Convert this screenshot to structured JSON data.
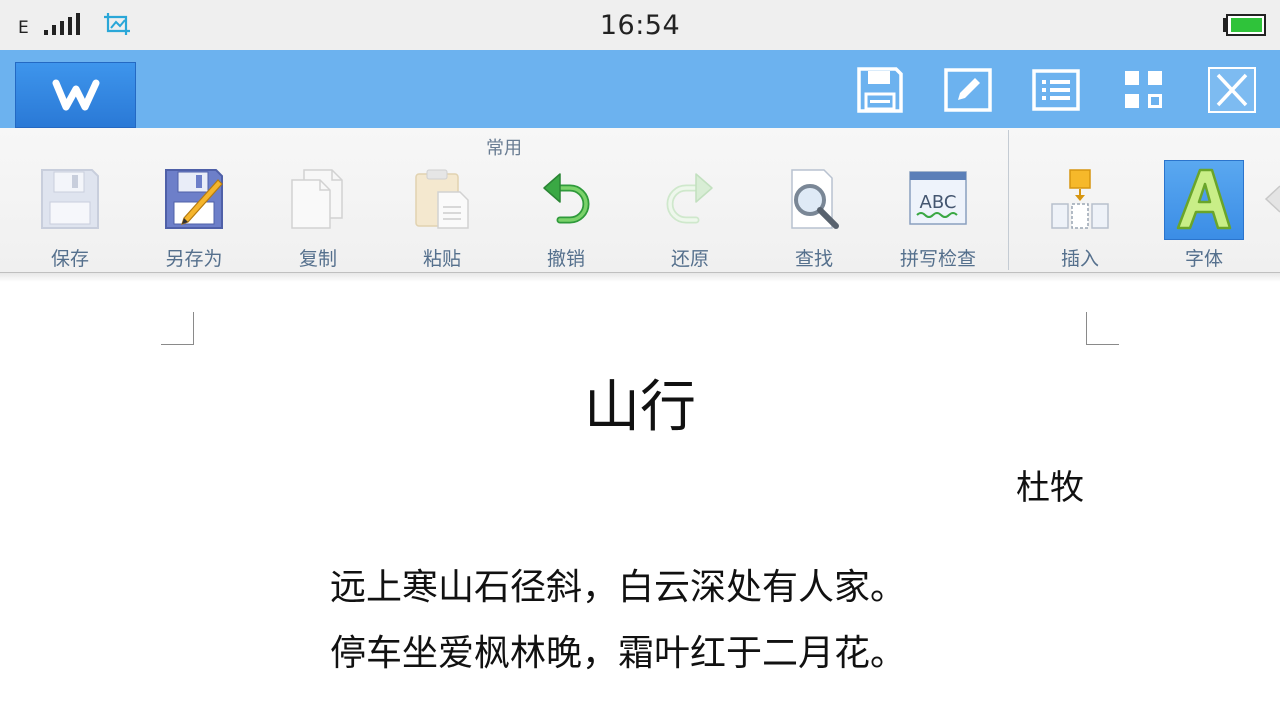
{
  "status_bar": {
    "network_type": "E",
    "time": "16:54",
    "icons": [
      "signal-icon",
      "screenshot-icon",
      "battery-icon"
    ],
    "battery_color": "#2fc33a"
  },
  "title_bar": {
    "logo_letter": "W",
    "logo_color": "#3a8fe8",
    "background": "#6cb2ef",
    "buttons": [
      "save-icon",
      "edit-icon",
      "list-icon",
      "grid-icon",
      "close-icon"
    ]
  },
  "ribbon": {
    "group_label": "常用",
    "buttons": [
      {
        "label": "保存",
        "icon": "save-icon",
        "enabled": false
      },
      {
        "label": "另存为",
        "icon": "save-as-icon",
        "enabled": true
      },
      {
        "label": "复制",
        "icon": "copy-icon",
        "enabled": false
      },
      {
        "label": "粘贴",
        "icon": "paste-icon",
        "enabled": false
      },
      {
        "label": "撤销",
        "icon": "undo-icon",
        "enabled": true
      },
      {
        "label": "还原",
        "icon": "redo-icon",
        "enabled": false
      },
      {
        "label": "查找",
        "icon": "find-icon",
        "enabled": true
      },
      {
        "label": "拼写检查",
        "icon": "spellcheck-icon",
        "enabled": true
      },
      {
        "label": "插入",
        "icon": "insert-icon",
        "enabled": true
      },
      {
        "label": "字体",
        "icon": "font-icon",
        "enabled": true,
        "selected": true
      }
    ]
  },
  "document": {
    "title": "山行",
    "author": "杜牧",
    "lines": [
      "远上寒山石径斜，白云深处有人家。",
      "停车坐爱枫林晚，霜叶红于二月花。"
    ]
  }
}
